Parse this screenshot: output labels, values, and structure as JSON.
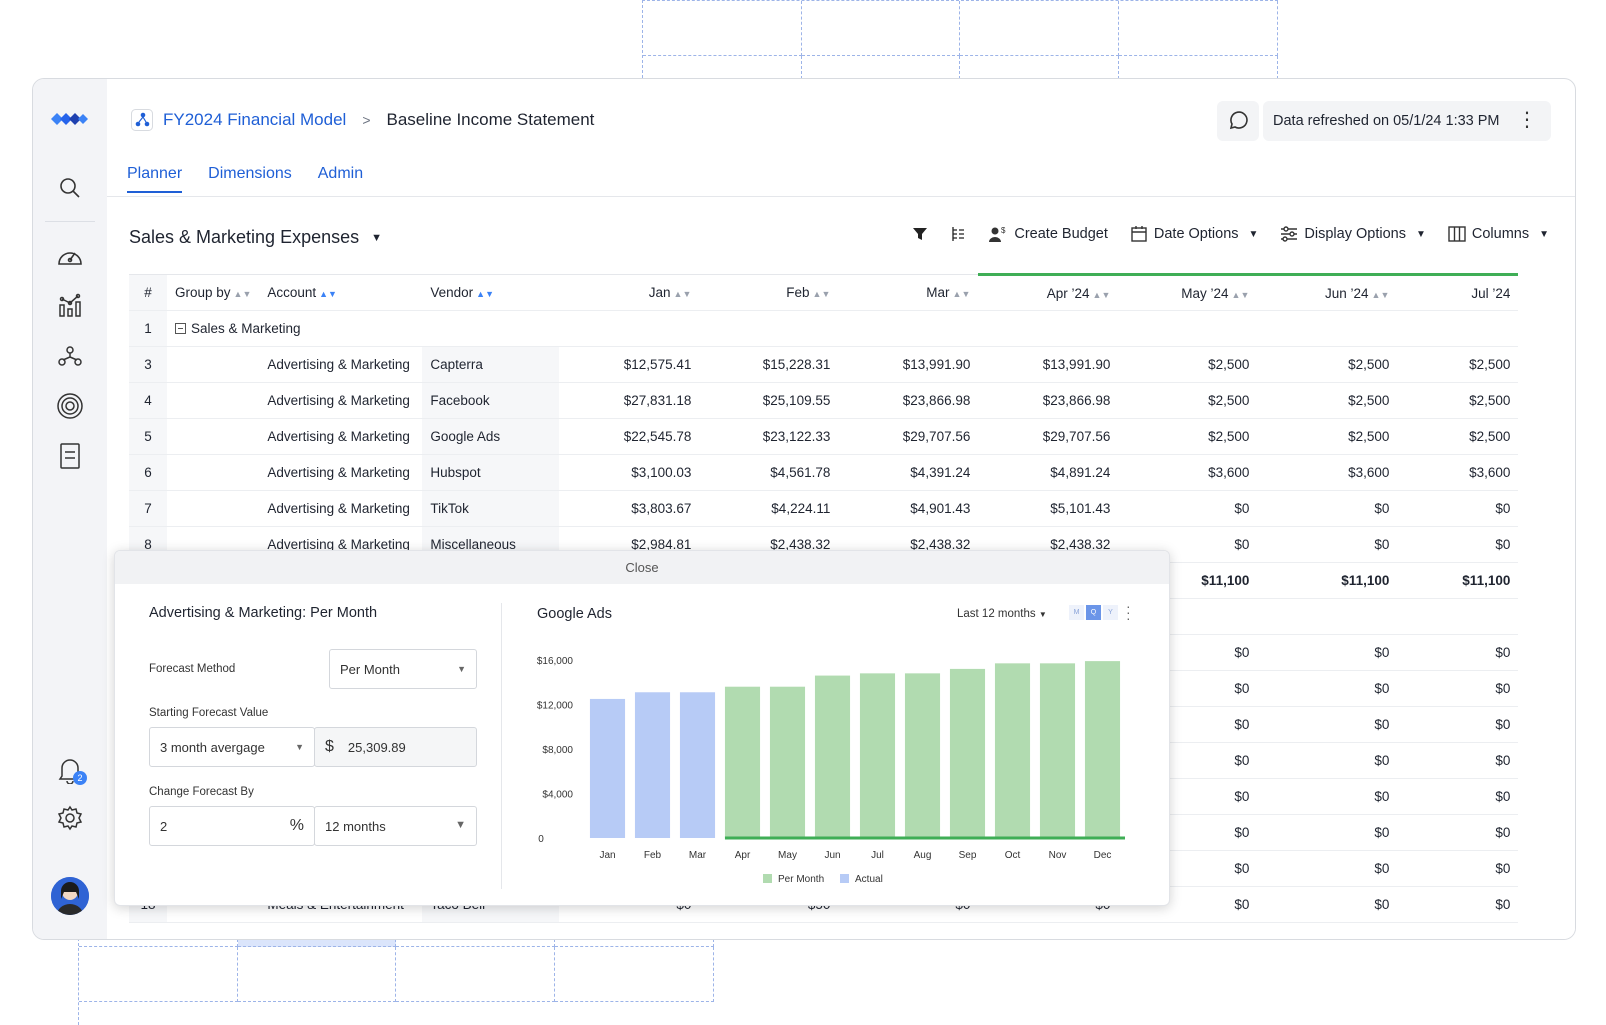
{
  "app": {
    "model_name": "FY2024 Financial Model",
    "breadcrumb_separator": ">",
    "report_name": "Baseline Income Statement",
    "refresh_text": "Data refreshed on 05/1/24 1:33 PM",
    "notification_count": "2"
  },
  "tabs": [
    {
      "label": "Planner",
      "active": true
    },
    {
      "label": "Dimensions",
      "active": false
    },
    {
      "label": "Admin",
      "active": false
    }
  ],
  "toolbar": {
    "sheet_title": "Sales & Marketing Expenses",
    "create_budget": "Create Budget",
    "date_options": "Date Options",
    "display_options": "Display Options",
    "columns": "Columns"
  },
  "table": {
    "headers": [
      "#",
      "Group by",
      "Account",
      "Vendor",
      "Jan",
      "Feb",
      "Mar",
      "Apr ’24",
      "May ’24",
      "Jun ’24",
      "Jul ’24"
    ],
    "group_row": {
      "index": "1",
      "label": "Sales & Marketing"
    },
    "rows": [
      {
        "index": "3",
        "account": "Advertising & Marketing",
        "vendor": "Capterra",
        "values": [
          "$12,575.41",
          "$15,228.31",
          "$13,991.90",
          "$13,991.90",
          "$2,500",
          "$2,500",
          "$2,500"
        ]
      },
      {
        "index": "4",
        "account": "Advertising & Marketing",
        "vendor": "Facebook",
        "values": [
          "$27,831.18",
          "$25,109.55",
          "$23,866.98",
          "$23,866.98",
          "$2,500",
          "$2,500",
          "$2,500"
        ]
      },
      {
        "index": "5",
        "account": "Advertising & Marketing",
        "vendor": "Google Ads",
        "values": [
          "$22,545.78",
          "$23,122.33",
          "$29,707.56",
          "$29,707.56",
          "$2,500",
          "$2,500",
          "$2,500"
        ]
      },
      {
        "index": "6",
        "account": "Advertising & Marketing",
        "vendor": "Hubspot",
        "values": [
          "$3,100.03",
          "$4,561.78",
          "$4,391.24",
          "$4,891.24",
          "$3,600",
          "$3,600",
          "$3,600"
        ]
      },
      {
        "index": "7",
        "account": "Advertising & Marketing",
        "vendor": "TikTok",
        "values": [
          "$3,803.67",
          "$4,224.11",
          "$4,901.43",
          "$5,101.43",
          "$0",
          "$0",
          "$0"
        ]
      },
      {
        "index": "8",
        "account": "Advertising & Marketing",
        "vendor": "Miscellaneous",
        "values": [
          "$2,984.81",
          "$2,438.32",
          "$2,438.32",
          "$2,438.32",
          "$0",
          "$0",
          "$0"
        ]
      }
    ],
    "total_values": [
      "$11,100",
      "$11,100",
      "$11,100"
    ],
    "zero_value": "$0",
    "last_row": {
      "index": "18",
      "account": "Meals & Entertainment",
      "vendor": "Taco Bell",
      "values": [
        "$0",
        "$50",
        "$0",
        "$0"
      ]
    }
  },
  "panel": {
    "close_label": "Close",
    "title": "Advertising & Marketing: Per Month",
    "forecast_method_label": "Forecast Method",
    "forecast_method_value": "Per Month",
    "starting_value_label": "Starting Forecast Value",
    "starting_method": "3 month avergage",
    "currency_symbol": "$",
    "starting_value": "25,309.89",
    "change_label": "Change Forecast By",
    "change_value": "2",
    "percent_symbol": "%",
    "change_period": "12 months"
  },
  "chart_data": {
    "type": "bar",
    "title": "Google Ads",
    "range_label": "Last 12 months",
    "granularity": [
      "M",
      "Q",
      "Y"
    ],
    "selected_granularity": "Q",
    "categories": [
      "Jan",
      "Feb",
      "Mar",
      "Apr",
      "May",
      "Jun",
      "Jul",
      "Aug",
      "Sep",
      "Oct",
      "Nov",
      "Dec"
    ],
    "values": [
      12500,
      13100,
      13100,
      13600,
      13600,
      14600,
      14800,
      14800,
      15200,
      15700,
      15700,
      15900
    ],
    "actual_count": 3,
    "y_ticks": [
      "0",
      "$4,000",
      "$8,000",
      "$12,000",
      "$16,000"
    ],
    "ylim": [
      0,
      16000
    ],
    "legend": [
      "Per Month",
      "Actual"
    ],
    "legend_placement": "bottom-center",
    "colors": {
      "per_month": "#b1dbb0",
      "actual": "#b7cbf6",
      "baseline": "#3fae56"
    }
  }
}
